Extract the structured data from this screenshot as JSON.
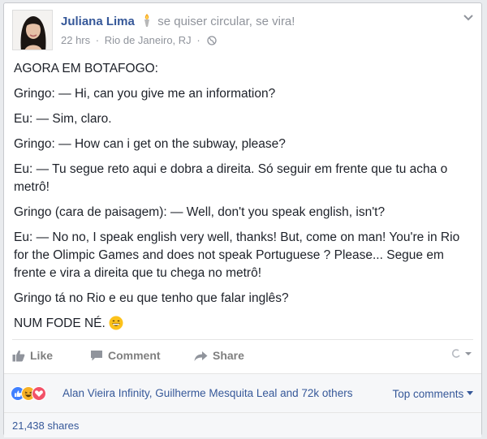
{
  "post": {
    "author": "Juliana Lima",
    "feeling": "se quiser circular, se vira!",
    "time": "22 hrs",
    "location": "Rio de Janeiro, RJ",
    "separator": "·",
    "lines": [
      "AGORA EM BOTAFOGO:",
      "Gringo: — Hi, can you give me an information?",
      "Eu: — Sim, claro.",
      "Gringo: — How can i get on the subway, please?",
      "Eu: — Tu segue reto aqui e dobra a direita. Só seguir em frente que tu acha o metrô!",
      "Gringo (cara de paisagem): — Well, don't you speak english, isn't?",
      "Eu: — No no, I speak english very well, thanks! But, come on man! You're in Rio for the Olimpic Games and does not speak Portuguese ? Please... Segue em frente e vira a direita que tu chega no metrô!",
      "Gringo tá no Rio e eu que tenho que falar inglês?",
      "NUM FODE NÉ."
    ]
  },
  "actions": {
    "like": "Like",
    "comment": "Comment",
    "share": "Share"
  },
  "reactions": {
    "names": "Alan Vieira Infinity, Guilherme Mesquita Leal and 72k others",
    "top_comments": "Top comments",
    "colors": {
      "like": "#4080ff",
      "haha": "#f7b125",
      "love": "#f25268"
    }
  },
  "shares": "21,438 shares",
  "icons": {
    "like": "thumbs-up-icon",
    "comment": "speech-bubble-icon",
    "share": "share-arrow-icon",
    "globe": "globe-icon",
    "torch": "olympic-torch-icon",
    "emoji": "grinning-face-icon"
  }
}
